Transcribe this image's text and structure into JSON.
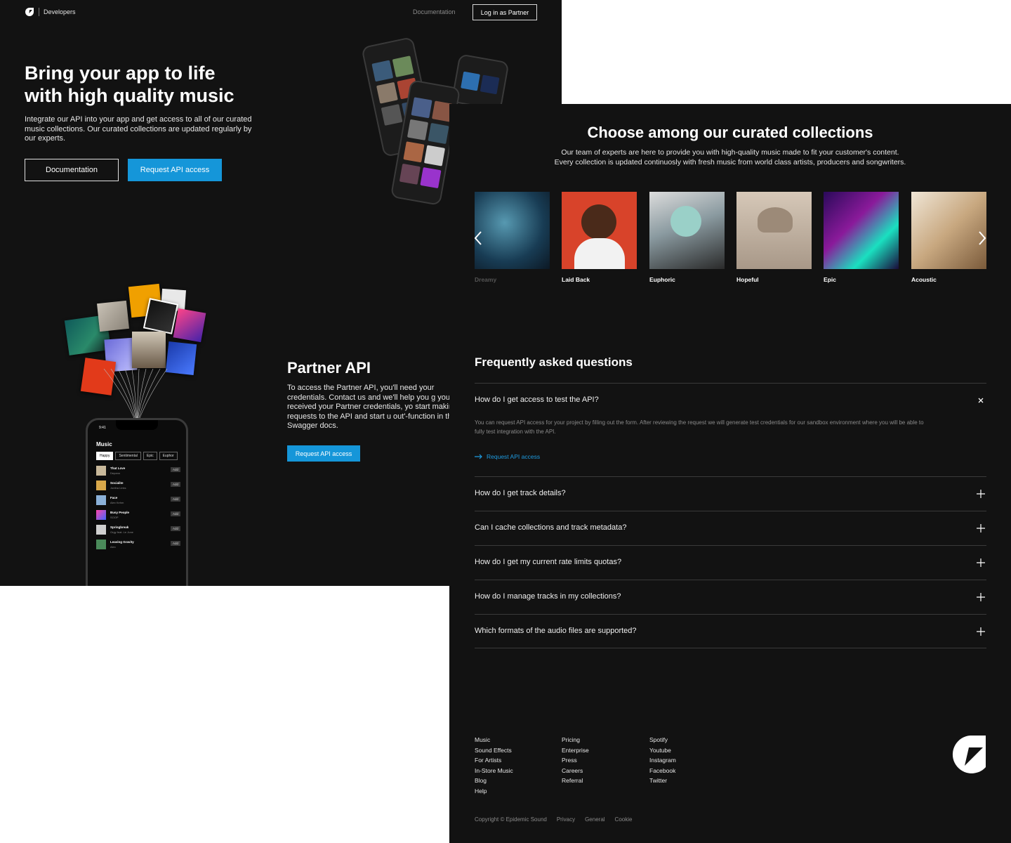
{
  "header": {
    "brand": "Developers",
    "documentation_link": "Documentation",
    "login_button": "Log in as Partner"
  },
  "hero": {
    "title_line1": "Bring your app to life",
    "title_line2": "with high quality music",
    "description": "Integrate our API into your app and get access to all of our curated music collections. Our curated collections are updated regularly by our experts.",
    "documentation_button": "Documentation",
    "request_button": "Request API access"
  },
  "phone_mockup": {
    "time": "9:41",
    "title": "Music",
    "chips": [
      "Happy",
      "Sentimental",
      "Epic",
      "Euphor"
    ],
    "tracks": [
      {
        "name": "That Love",
        "artist": "Depano",
        "add": "Add"
      },
      {
        "name": "Socialite",
        "artist": "Jontha Links",
        "add": "Add"
      },
      {
        "name": "Face",
        "artist": "Alex Kehm",
        "add": "Add"
      },
      {
        "name": "Busy People",
        "artist": "SOOP",
        "add": "Add"
      },
      {
        "name": "Springbreak",
        "artist": "Orgy feat. Le June",
        "add": "Add"
      },
      {
        "name": "Leaving Gravity",
        "artist": "Alex",
        "add": "Add"
      }
    ]
  },
  "partner": {
    "title": "Partner API",
    "description": "To access the Partner API, you'll need your credentials. Contact us and we'll help you g you've received your Partner credentials, yo start making requests to the API and start u out'-function in the Swagger docs.",
    "button": "Request API access"
  },
  "collections": {
    "title": "Choose among our curated collections",
    "subtitle_line1": "Our team of experts are here to provide you with high-quality music made to fit your customer's content.",
    "subtitle_line2": "Every collection is updated continuosly with fresh music from world class artists, producers and songwriters.",
    "items": [
      "Dreamy",
      "Laid Back",
      "Euphoric",
      "Hopeful",
      "Epic",
      "Acoustic"
    ]
  },
  "faq": {
    "title": "Frequently asked questions",
    "open_question": "How do I get access to test the API?",
    "open_answer": "You can request API access for your project by filling out the form. After reviewing the request we will generate test credentials for our sandbox environment where you will be able to fully test integration with the API.",
    "open_link": "Request API access",
    "questions": [
      "How do I get track details?",
      "Can I cache collections and track metadata?",
      "How do I get my current rate limits quotas?",
      "How do I manage tracks in my collections?",
      "Which formats of the audio files are supported?"
    ]
  },
  "footer": {
    "col1": [
      "Music",
      "Sound Effects",
      "For Artists",
      "In-Store Music",
      "Blog",
      "Help"
    ],
    "col2": [
      "Pricing",
      "Enterprise",
      "Press",
      "Careers",
      "Referral"
    ],
    "col3": [
      "Spotify",
      "Youtube",
      "Instagram",
      "Facebook",
      "Twitter"
    ],
    "copyright": "Copyright © Epidemic Sound",
    "legal": [
      "Privacy",
      "General",
      "Cookie"
    ]
  },
  "colors": {
    "background": "#121212",
    "accent": "#1596d9",
    "text": "#ffffff"
  }
}
